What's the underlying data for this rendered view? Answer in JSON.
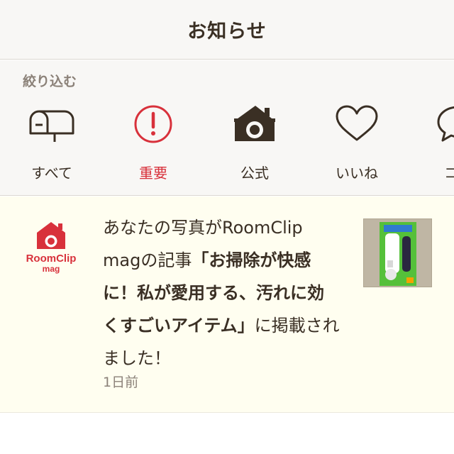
{
  "header": {
    "title": "お知らせ"
  },
  "filter": {
    "label": "絞り込む",
    "tabs": [
      {
        "label": "すべて",
        "icon": "mailbox-icon"
      },
      {
        "label": "重要",
        "icon": "exclamation-circle-icon"
      },
      {
        "label": "公式",
        "icon": "camera-house-icon"
      },
      {
        "label": "いいね",
        "icon": "heart-icon"
      },
      {
        "label": "コメ",
        "icon": "comment-icon"
      }
    ]
  },
  "notices": [
    {
      "logo_text_top": "RoomClip",
      "logo_text_bottom": "mag",
      "text_before": "あなたの写真がRoomClip magの記事",
      "text_bold": "「お掃除が快感に！私が愛用する、汚れに効くすごいアイテム」",
      "text_after": "に掲載されました！",
      "time": "1日前"
    }
  ],
  "colors": {
    "accent_red": "#d8313b",
    "brown_text": "#3a2f24",
    "muted_text": "#8b8178",
    "notice_bg": "#fffef0"
  }
}
